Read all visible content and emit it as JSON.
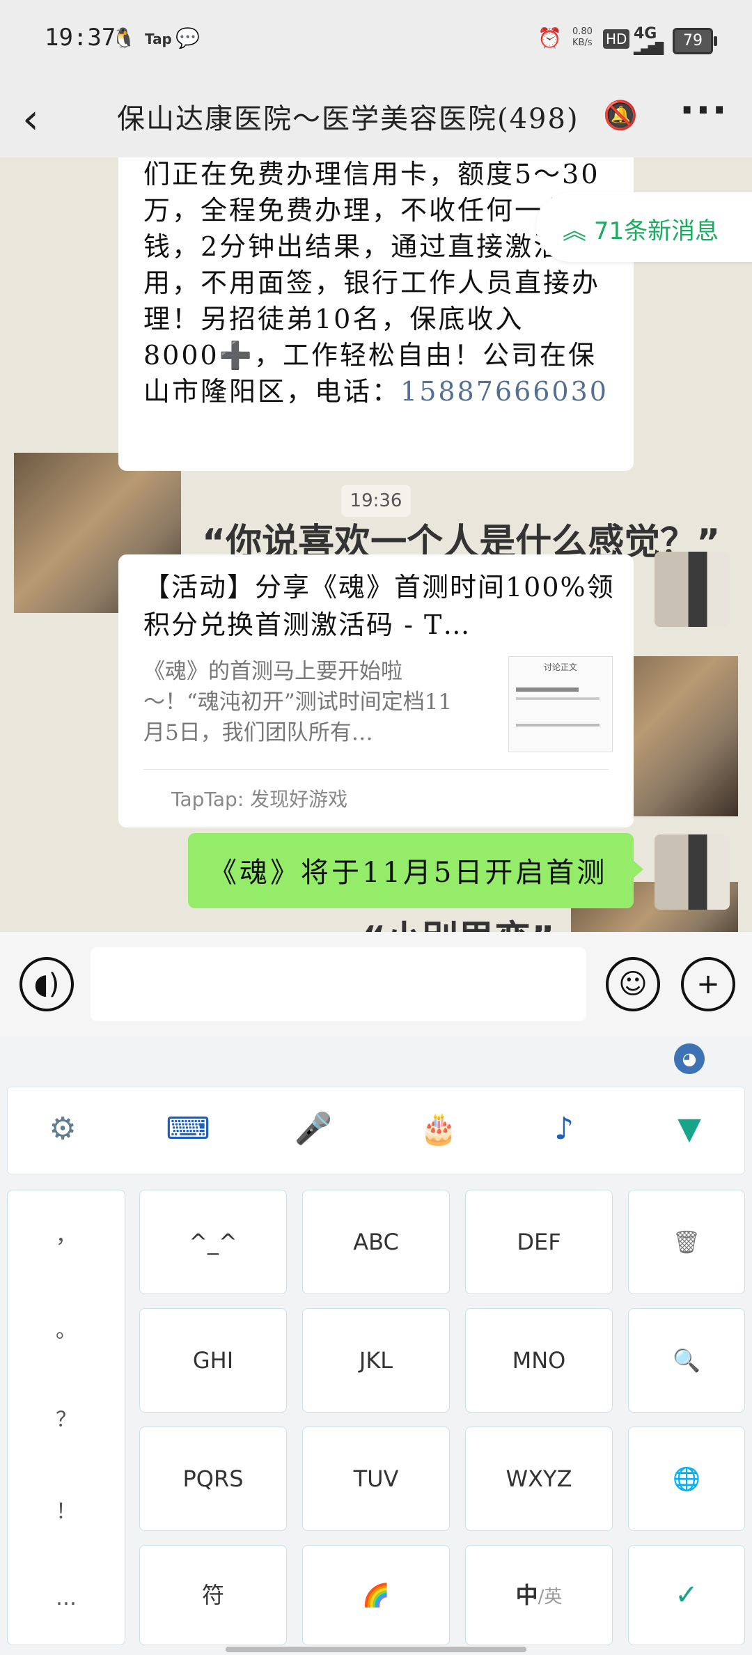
{
  "status_bar": {
    "time": "19:37",
    "tap_label": "Tap",
    "speed": "0.80\nKB/s",
    "hd": "HD",
    "network": "4G",
    "battery": "79"
  },
  "header": {
    "title": "保山达康医院～医学美容医院(498)"
  },
  "chat": {
    "message1_text": "们正在免费办理信用卡，额度5～30万，全程免费办理，不收任何一分钱，2分钟出结果，通过直接激活使用，不用面签，银行工作人员直接办理！另招徒弟10名，保底收入8000➕，工作轻松自由！公司在保山市隆阳区，电话：",
    "message1_phone": "15887666030",
    "new_messages": "71条新消息",
    "timestamp": "19:36",
    "background_text_1": "“你说喜欢一个人是什么感觉？”",
    "background_text_2": "“小别思恋”",
    "card": {
      "title": "【活动】分享《魂》首测时间100%领积分兑换首测激活码 - T…",
      "description": "《魂》的首测马上要开始啦～！“魂沌初开”测试时间定档11月5日，我们团队所有…",
      "thumbnail_heading": "讨论正文",
      "source": "TapTap: 发现好游戏"
    },
    "sent_message": "《魂》将于11月5日开启首测"
  },
  "input": {
    "placeholder": ""
  },
  "keyboard": {
    "punctuation": [
      "，",
      "。",
      "？",
      "！",
      "…"
    ],
    "keys": [
      [
        "^_^",
        "ABC",
        "DEF"
      ],
      [
        "GHI",
        "JKL",
        "MNO"
      ],
      [
        "PQRS",
        "TUV",
        "WXYZ"
      ]
    ],
    "bottom": {
      "symbols": "符",
      "lang_main": "中",
      "lang_alt": "/英"
    }
  },
  "colors": {
    "accent_green": "#1aad5f",
    "sent_bubble": "#95ec69",
    "phone_link": "#546f94"
  }
}
